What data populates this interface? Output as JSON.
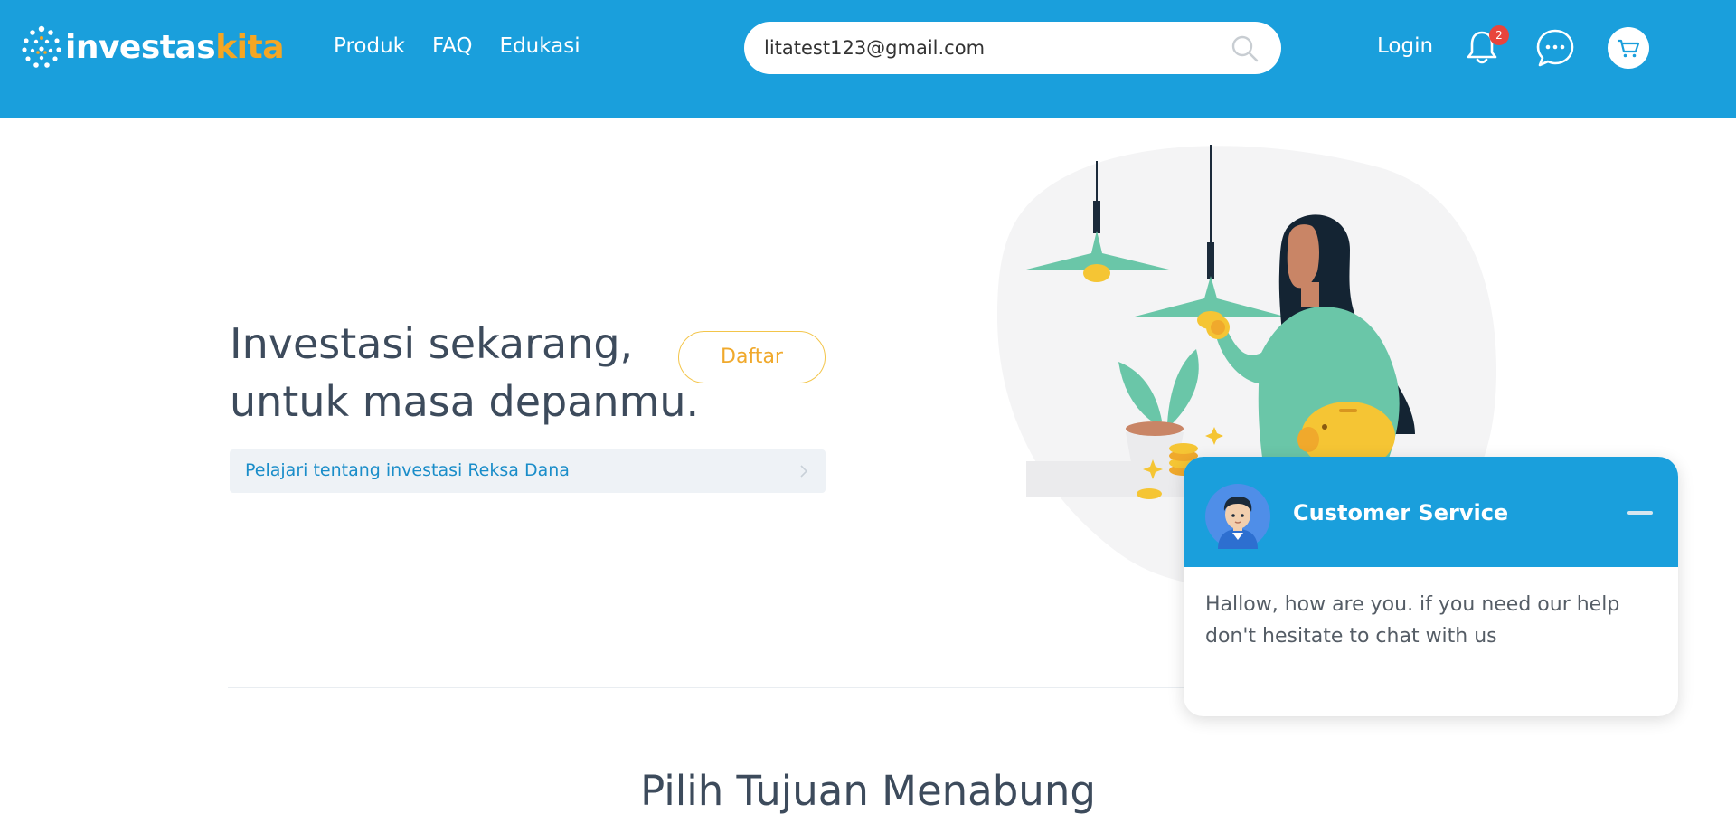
{
  "header": {
    "logo": {
      "text_main": "investas",
      "text_accent": "kita"
    },
    "nav": [
      "Produk",
      "FAQ",
      "Edukasi"
    ],
    "search": {
      "value": "litatest123@gmail.com",
      "placeholder": ""
    },
    "login_label": "Login",
    "notification_count": "2",
    "icons": [
      "search-icon",
      "bell-icon",
      "chat-bubble-icon",
      "cart-icon"
    ]
  },
  "hero": {
    "title_line1": "Investasi sekarang,",
    "title_line2": "untuk masa depanmu.",
    "register_label": "Daftar",
    "learn_link": "Pelajari tentang investasi Reksa Dana"
  },
  "section": {
    "title": "Pilih Tujuan Menabung"
  },
  "chat_widget": {
    "title": "Customer Service",
    "message": "Hallow, how are you. if you need our help don't hesitate to chat with us"
  },
  "colors": {
    "brand_blue": "#1a9fdc",
    "accent_orange": "#f5a623",
    "text_dark": "#3d4b5c",
    "badge_red": "#e8453c",
    "illustration_green": "#6ac6a8"
  }
}
